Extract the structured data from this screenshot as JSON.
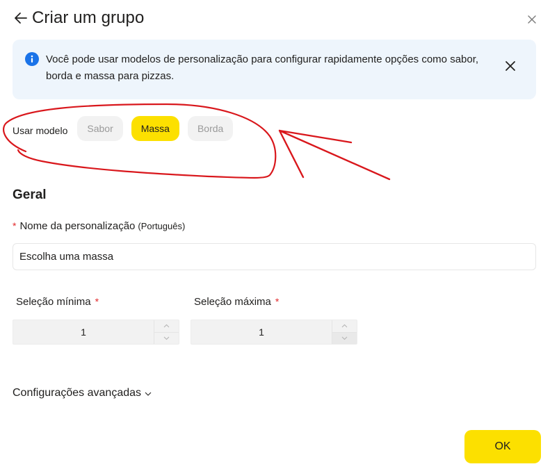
{
  "header": {
    "title": "Criar um grupo"
  },
  "info_banner": {
    "text": "Você pode usar modelos de personalização para configurar rapidamente opções como sabor, borda e massa para pizzas."
  },
  "template": {
    "label": "Usar modelo",
    "chips": [
      {
        "label": "Sabor",
        "active": false
      },
      {
        "label": "Massa",
        "active": true
      },
      {
        "label": "Borda",
        "active": false
      }
    ]
  },
  "general": {
    "title": "Geral",
    "name_field": {
      "label": "Nome da personalização",
      "lang_note": "(Português)",
      "value": "Escolha uma massa"
    },
    "min_selection": {
      "label": "Seleção mínima",
      "value": "1"
    },
    "max_selection": {
      "label": "Seleção máxima",
      "value": "1"
    },
    "required_mark": "*"
  },
  "advanced": {
    "label": "Configurações avançadas"
  },
  "footer": {
    "ok_label": "OK"
  },
  "colors": {
    "accent_yellow": "#fce000",
    "banner_bg": "#eef5fc",
    "info_blue": "#1a73e8",
    "required_red": "#e2292b",
    "annotation_red": "#d9171c"
  }
}
